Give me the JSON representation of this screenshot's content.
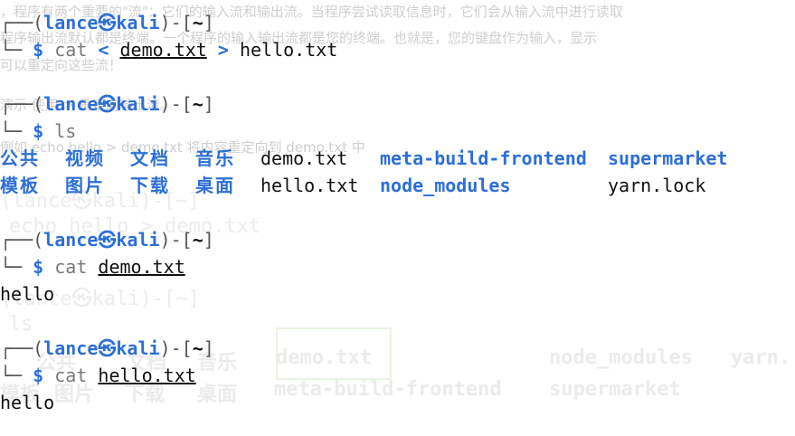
{
  "background": {
    "line1": "，程序有两个重要的\"流\"：它们的输入流和输出流。当程序尝试读取信息时，它们会从输入流中进行读取",
    "line2": "程序输出流默认都是终端。一个程序的输入输出流都是您的终端。也就是，您的键盘作为输入，显示",
    "line3": "可以重定向这些流！",
    "line4": "演示 使用 > 重定向输出流。",
    "line5": "例如 echo hello > demo.txt 将内容重定向到 demo.txt 中",
    "ghost_prompt": "(lance㉿kali)-[~]",
    "ghost_cmd": "echo hello > demo.txt",
    "ghost_prompt2": "(lance㉿kali)-[~]",
    "ghost_ls": "ls",
    "ghost_row1": [
      "公共",
      "文档",
      "音乐",
      "demo.txt",
      "node_modules",
      "yarn."
    ],
    "ghost_row2": [
      "模板",
      "图片",
      "下载",
      "桌面",
      "meta-build-frontend",
      "supermarket"
    ]
  },
  "prompt": {
    "open": "┌──(",
    "user": "lance",
    "at": "㉿",
    "host": "kali",
    "close": ")-[",
    "dir": "~",
    "end": "]",
    "bottom": "└─",
    "dollar": "$"
  },
  "commands": [
    {
      "cmd": "cat",
      "parts": [
        "<",
        "demo.txt",
        ">",
        "hello.txt"
      ]
    },
    {
      "cmd": "ls"
    },
    {
      "cmd": "cat",
      "arg": "demo.txt",
      "output": "hello"
    },
    {
      "cmd": "cat",
      "arg": "hello.txt",
      "output": "hello"
    }
  ],
  "ls_output": {
    "row1": [
      "公共",
      "视频",
      "文档",
      "音乐",
      "demo.txt",
      "meta-build-frontend",
      "supermarket"
    ],
    "row2": [
      "模板",
      "图片",
      "下载",
      "桌面",
      "hello.txt",
      "node_modules",
      "yarn.lock"
    ]
  },
  "colors": {
    "accent_blue": "#2d6fd6",
    "frame_gray": "#555555",
    "background": "#ffffff"
  }
}
